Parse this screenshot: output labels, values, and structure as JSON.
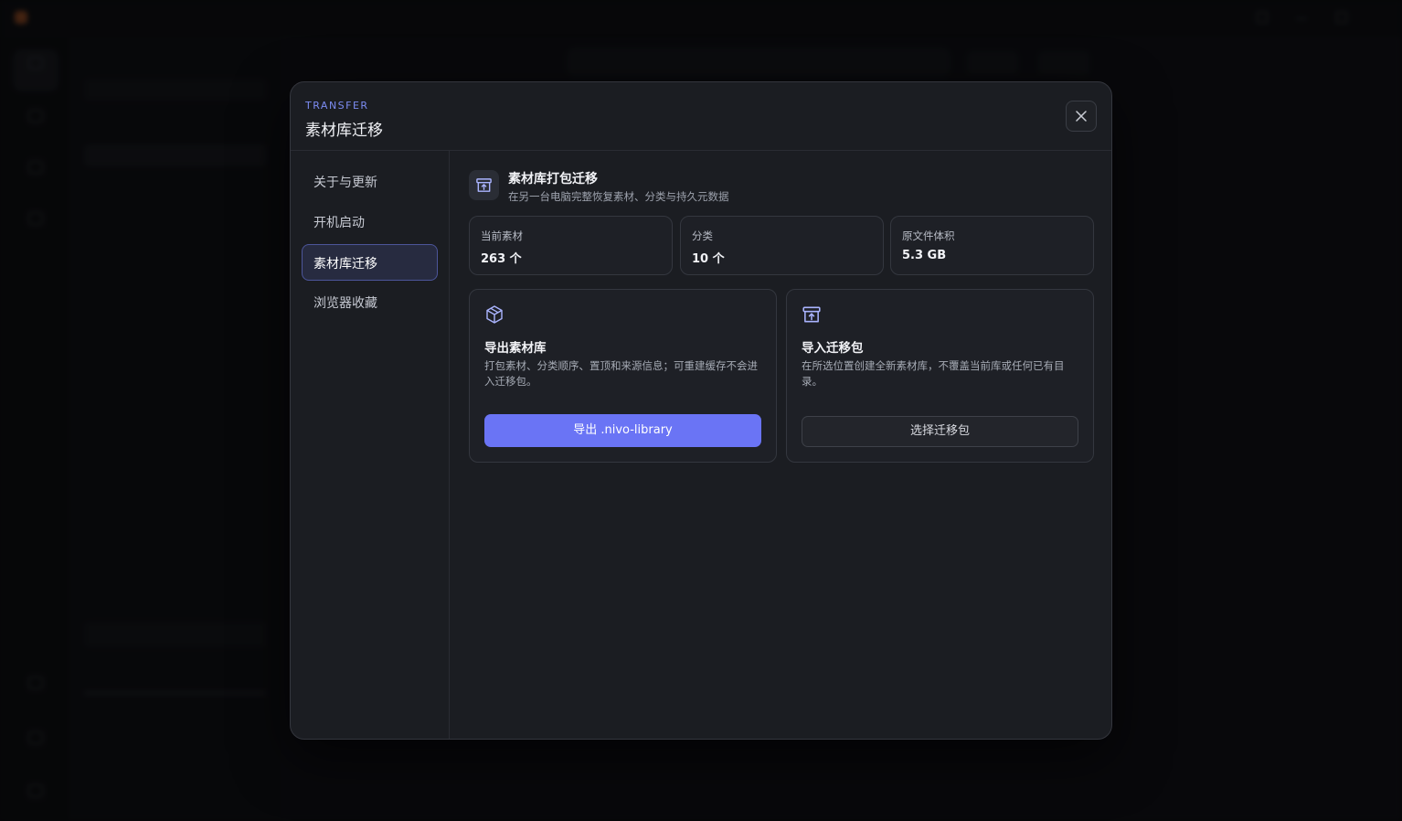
{
  "modal": {
    "eyebrow": "TRANSFER",
    "title": "素材库迁移"
  },
  "nav": {
    "items": [
      {
        "label": "关于与更新"
      },
      {
        "label": "开机启动"
      },
      {
        "label": "素材库迁移",
        "active": true
      },
      {
        "label": "浏览器收藏"
      }
    ]
  },
  "section": {
    "title": "素材库打包迁移",
    "subtitle": "在另一台电脑完整恢复素材、分类与持久元数据"
  },
  "stats": [
    {
      "label": "当前素材",
      "value": "263 个"
    },
    {
      "label": "分类",
      "value": "10 个"
    },
    {
      "label": "原文件体积",
      "value": "5.3 GB"
    }
  ],
  "export_card": {
    "title": "导出素材库",
    "description": "打包素材、分类顺序、置顶和来源信息；可重建缓存不会进入迁移包。",
    "button": "导出 .nivo-library"
  },
  "import_card": {
    "title": "导入迁移包",
    "description": "在所选位置创建全新素材库，不覆盖当前库或任何已有目录。",
    "button": "选择迁移包"
  },
  "colors": {
    "accent": "#6a74f5",
    "eyebrow": "#7c8cf2",
    "modal_bg": "#1b1d22"
  }
}
